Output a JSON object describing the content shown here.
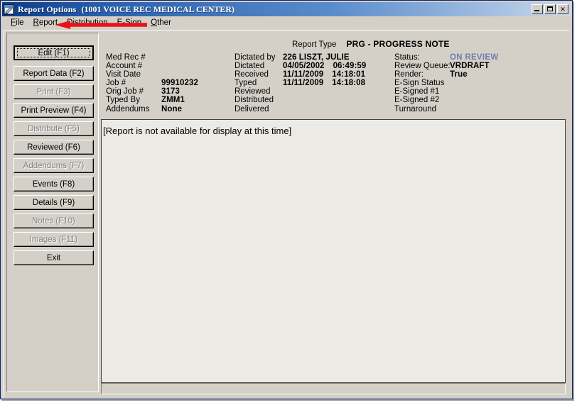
{
  "window": {
    "title": "Report Options",
    "subtitle": "(1001 VOICE REC MEDICAL CENTER)",
    "icon": "document-pencil-icon",
    "controls": {
      "minimize": "minimize-button",
      "maximize": "maximize-button",
      "close_label": "✕"
    }
  },
  "menubar": {
    "items": [
      {
        "label": "File",
        "accel": "F"
      },
      {
        "label": "Report",
        "accel": "R"
      },
      {
        "label": "Distribution",
        "accel": "D"
      },
      {
        "label": "E-Sign",
        "accel": "S"
      },
      {
        "label": "Other",
        "accel": "O"
      }
    ]
  },
  "annotation": {
    "type": "red-arrow",
    "color": "#e8121b",
    "points_to": "Report"
  },
  "sidebar": {
    "buttons": [
      {
        "label": "Edit (F1)",
        "enabled": true,
        "focused": true
      },
      {
        "label": "Report Data (F2)",
        "enabled": true,
        "focused": false
      },
      {
        "label": "Print (F3)",
        "enabled": false,
        "focused": false
      },
      {
        "label": "Print Preview (F4)",
        "enabled": true,
        "focused": false
      },
      {
        "label": "Distribute (F5)",
        "enabled": false,
        "focused": false
      },
      {
        "label": "Reviewed (F6)",
        "enabled": true,
        "focused": false
      },
      {
        "label": "Addendums (F7)",
        "enabled": false,
        "focused": false
      },
      {
        "label": "Events (F8)",
        "enabled": true,
        "focused": false
      },
      {
        "label": "Details (F9)",
        "enabled": true,
        "focused": false
      },
      {
        "label": "Notes (F10)",
        "enabled": false,
        "focused": false
      },
      {
        "label": "Images (F11)",
        "enabled": false,
        "focused": false
      },
      {
        "label": "Exit",
        "enabled": true,
        "focused": false
      }
    ]
  },
  "report_header": {
    "report_type_label": "Report Type",
    "report_type_value": "PRG - PROGRESS NOTE",
    "column1": [
      {
        "label": "Med Rec #",
        "value": ""
      },
      {
        "label": "Account #",
        "value": ""
      },
      {
        "label": "Visit Date",
        "value": ""
      },
      {
        "label": "Job #",
        "value": "99910232"
      },
      {
        "label": "Orig Job #",
        "value": "3173"
      },
      {
        "label": "Typed By",
        "value": "ZMM1"
      },
      {
        "label": "Addendums",
        "value": "None"
      }
    ],
    "column2": [
      {
        "label": "Dictated by",
        "value": "226 LISZT, JULIE",
        "value2": ""
      },
      {
        "label": "Dictated",
        "value": "04/05/2002",
        "value2": "06:49:59"
      },
      {
        "label": "Received",
        "value": "11/11/2009",
        "value2": "14:18:01"
      },
      {
        "label": "Typed",
        "value": "11/11/2009",
        "value2": "14:18:08"
      },
      {
        "label": "Reviewed",
        "value": "",
        "value2": ""
      },
      {
        "label": "Distributed",
        "value": "",
        "value2": ""
      },
      {
        "label": "Delivered",
        "value": "",
        "value2": ""
      }
    ],
    "column3": [
      {
        "label": "Status:",
        "value": "ON REVIEW",
        "status": true
      },
      {
        "label": "Review Queue:",
        "value": "VRDRAFT",
        "status": false
      },
      {
        "label": "Render:",
        "value": "True",
        "status": false
      },
      {
        "label": "E-Sign Status",
        "value": "",
        "status": false
      },
      {
        "label": "E-Signed #1",
        "value": "",
        "status": false
      },
      {
        "label": "E-Signed #2",
        "value": "",
        "status": false
      },
      {
        "label": "Turnaround",
        "value": "",
        "status": false
      }
    ]
  },
  "document_pane": {
    "message": "[Report is not available for display at this time]"
  },
  "colors": {
    "status_accent": "#7080ab",
    "window_face": "#d4d0c8",
    "doc_background": "#eceae4",
    "titlebar_dark": "#0b3c87",
    "titlebar_light": "#cfd9e8",
    "annotation_red": "#e8121b"
  }
}
